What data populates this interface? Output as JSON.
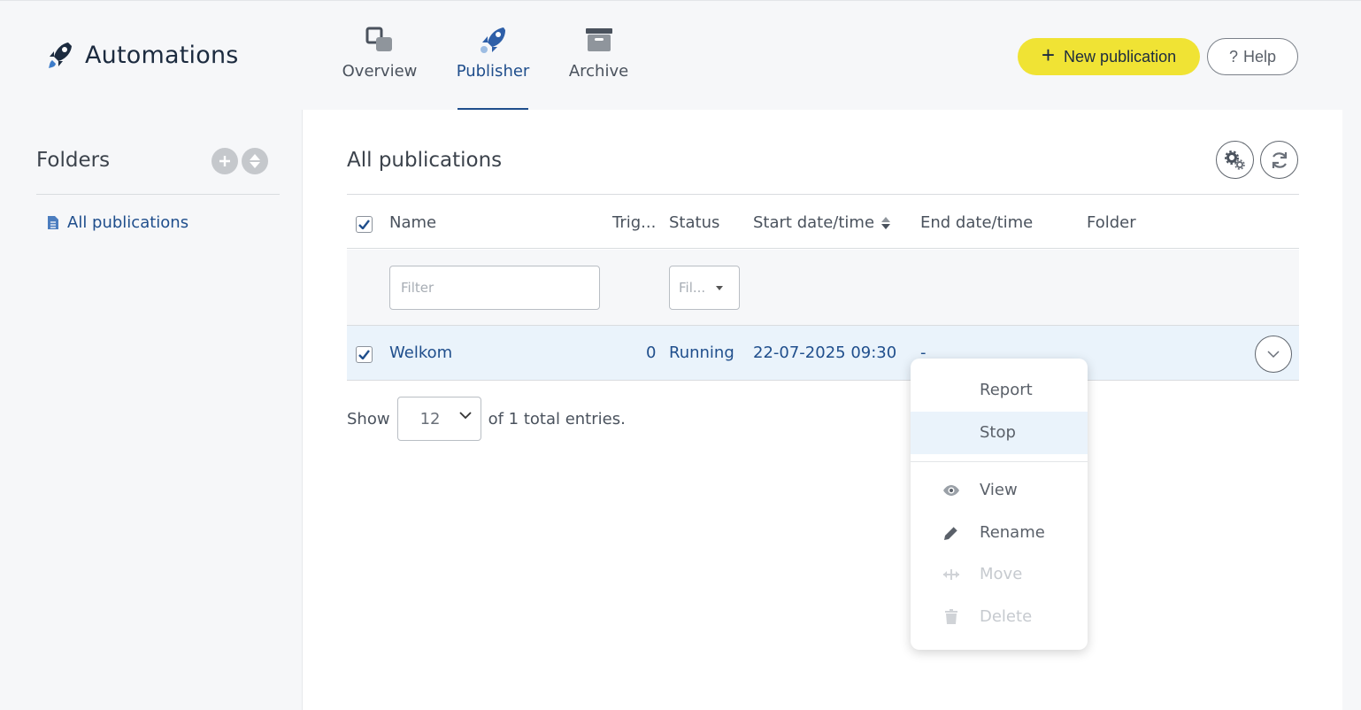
{
  "app": {
    "title": "Automations"
  },
  "nav": {
    "tabs": [
      {
        "label": "Overview",
        "icon": "overview-icon"
      },
      {
        "label": "Publisher",
        "icon": "rocket-icon",
        "active": true
      },
      {
        "label": "Archive",
        "icon": "archive-box-icon"
      }
    ]
  },
  "header": {
    "new_label": "New publication",
    "help_label": "Help",
    "help_glyph": "?"
  },
  "sidebar": {
    "title": "Folders",
    "items": [
      {
        "label": "All publications"
      }
    ]
  },
  "main": {
    "title": "All publications",
    "columns": [
      "Name",
      "Trig...",
      "Status",
      "Start date/time",
      "End date/time",
      "Folder"
    ],
    "filters": {
      "name_placeholder": "Filter",
      "status_placeholder": "Fil..."
    },
    "rows": [
      {
        "name": "Welkom",
        "triggers": "0",
        "status": "Running",
        "start": "22-07-2025 09:30",
        "end": "-",
        "folder": ""
      }
    ],
    "pager": {
      "show_label": "Show",
      "page_size": "12",
      "summary": "of 1 total entries."
    }
  },
  "row_menu": {
    "items": [
      {
        "label": "Report",
        "icon": "",
        "state": "normal"
      },
      {
        "label": "Stop",
        "icon": "",
        "state": "highlighted"
      },
      {
        "label": "View",
        "icon": "eye-icon",
        "state": "normal"
      },
      {
        "label": "Rename",
        "icon": "pencil-icon",
        "state": "normal"
      },
      {
        "label": "Move",
        "icon": "move-arrows-icon",
        "state": "disabled"
      },
      {
        "label": "Delete",
        "icon": "trash-icon",
        "state": "disabled"
      }
    ]
  },
  "colors": {
    "accent_blue": "#1f4e8c",
    "new_button_yellow": "#f0e334",
    "selected_row": "#eaf3fb",
    "background": "#f6f7f9"
  }
}
